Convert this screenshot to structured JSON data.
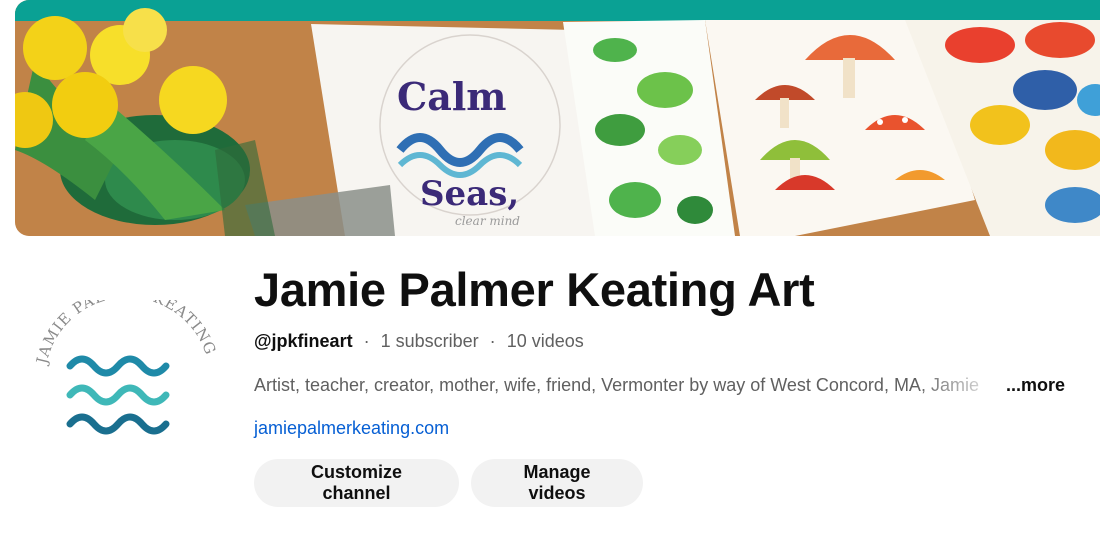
{
  "banner": {
    "accent_color": "#0aa194",
    "art_text_1": "Calm",
    "art_text_2": "Seas,",
    "art_text_3": "clear mind"
  },
  "avatar": {
    "logo_text": "JAMIE PALMER KEATING"
  },
  "channel": {
    "name": "Jamie Palmer Keating Art",
    "handle": "@jpkfineart",
    "separator": "·",
    "subscribers": "1 subscriber",
    "videos": "10 videos",
    "description": "Artist, teacher, creator, mother, wife, friend, Vermonter by way of West Concord, MA, Jamie",
    "more_label": "...more",
    "link": "jamiepalmerkeating.com"
  },
  "actions": {
    "customize_label": "Customize channel",
    "manage_label": "Manage videos"
  }
}
